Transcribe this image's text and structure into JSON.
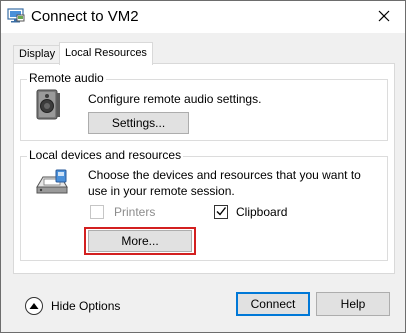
{
  "window": {
    "title": "Connect to VM2"
  },
  "tabs": [
    {
      "label": "Display"
    },
    {
      "label": "Local Resources"
    }
  ],
  "remote_audio": {
    "group_label": "Remote audio",
    "description": "Configure remote audio settings.",
    "settings_button": "Settings..."
  },
  "local_devices": {
    "group_label": "Local devices and resources",
    "description_line1": "Choose the devices and resources that you want to",
    "description_line2": "use in your remote session.",
    "printers": {
      "label": "Printers",
      "checked": false,
      "enabled": false
    },
    "clipboard": {
      "label": "Clipboard",
      "checked": true,
      "enabled": true
    },
    "more_button": "More..."
  },
  "footer": {
    "hide_options": "Hide Options",
    "connect_button": "Connect",
    "help_button": "Help"
  },
  "colors": {
    "highlight": "#d32020",
    "accent": "#0078d7"
  }
}
